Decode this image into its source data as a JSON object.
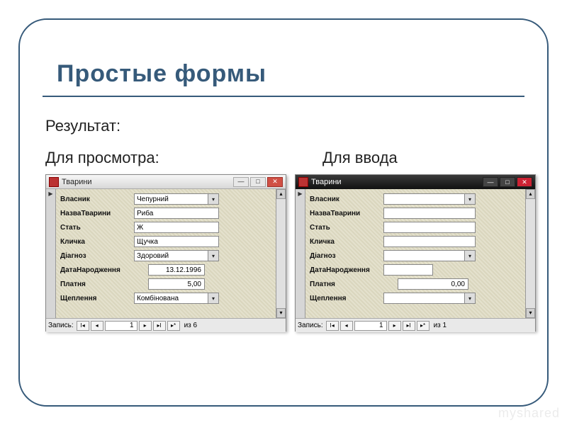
{
  "slide": {
    "title": "Простые формы",
    "result_label": "Результат:",
    "view_label": "Для просмотра:",
    "input_label": "Для ввода"
  },
  "labels": {
    "owner": "Власник",
    "animal_name": "НазваТварини",
    "sex": "Стать",
    "nickname": "Кличка",
    "diagnosis": "Діагноз",
    "birthdate": "ДатаНародження",
    "payment": "Платня",
    "vaccination": "Щеплення"
  },
  "formA": {
    "window_title": "Тварини",
    "owner": "Чепурний",
    "animal_name": "Риба",
    "sex": "Ж",
    "nickname": "Щучка",
    "diagnosis": "Здоровий",
    "birthdate": "13.12.1996",
    "payment": "5,00",
    "vaccination": "Комбінована",
    "nav_label": "Запись:",
    "nav_current": "1",
    "nav_of": "из 6"
  },
  "formB": {
    "window_title": "Тварини",
    "owner": "",
    "animal_name": "",
    "sex": "",
    "nickname": "",
    "diagnosis": "",
    "birthdate": "",
    "payment": "0,00",
    "vaccination": "",
    "nav_label": "Запись:",
    "nav_current": "1",
    "nav_of": "из 1"
  },
  "watermark": "myshared"
}
